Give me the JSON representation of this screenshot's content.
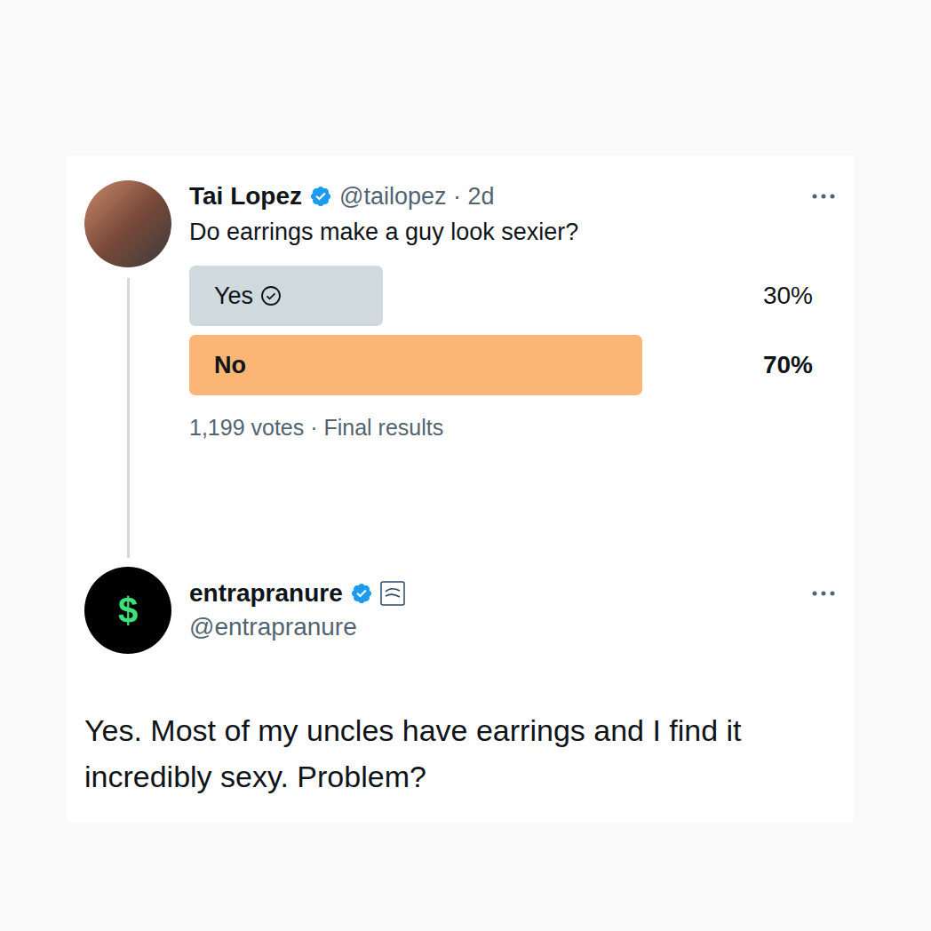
{
  "post": {
    "name": "Tai Lopez",
    "meta": "@tailopez · 2d",
    "verified": true,
    "text": "Do earrings make a guy look sexier?",
    "poll": {
      "options": [
        {
          "label": "Yes",
          "percent": "30%",
          "level": 0.3,
          "selected": true,
          "winner": false
        },
        {
          "label": "No",
          "percent": "70%",
          "level": 0.7,
          "selected": false,
          "winner": true
        }
      ],
      "footer": "1,199 votes · Final results"
    }
  },
  "reply": {
    "name": "entrapranure",
    "handle": "@entrapranure",
    "verified": true,
    "affiliate": true,
    "avatar": "$",
    "text": "Yes. Most of my uncles have earrings and I find it incredibly sexy. Problem?"
  }
}
